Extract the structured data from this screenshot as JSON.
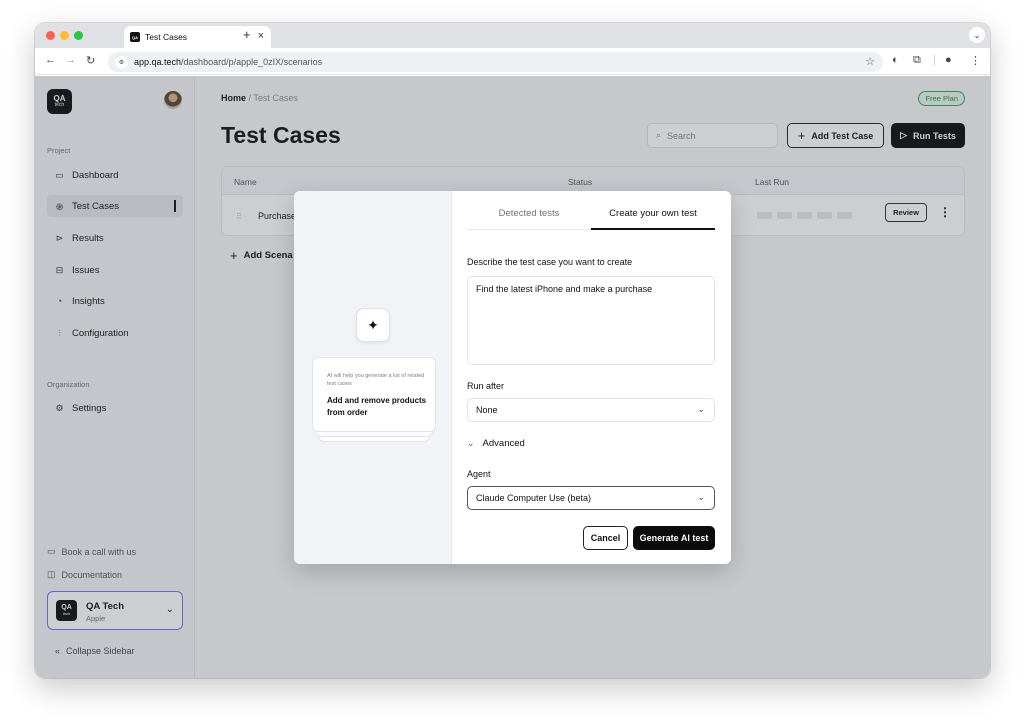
{
  "browser": {
    "tab_title": "Test Cases",
    "tab_favicon": "QA",
    "url_host": "app.qa.tech",
    "url_path": "/dashboard/p/apple_0zIX/scenarios"
  },
  "sidebar": {
    "logo_main": "QA",
    "logo_sub": "tech",
    "project_label": "Project",
    "items": [
      {
        "label": "Dashboard",
        "icon": "calendar-icon"
      },
      {
        "label": "Test Cases",
        "icon": "fingerprint-icon"
      },
      {
        "label": "Results",
        "icon": "play-circle-icon"
      },
      {
        "label": "Issues",
        "icon": "inbox-icon"
      },
      {
        "label": "Insights",
        "icon": "chart-pie-icon"
      },
      {
        "label": "Configuration",
        "icon": "sliders-icon"
      }
    ],
    "organization_label": "Organization",
    "settings_label": "Settings",
    "book_call": "Book a call with us",
    "documentation": "Documentation",
    "org_name": "QA Tech",
    "org_sub": "Apple",
    "collapse": "Collapse Sidebar"
  },
  "main": {
    "breadcrumb_home": "Home",
    "breadcrumb_sep": "/",
    "breadcrumb_current": "Test Cases",
    "plan_badge": "Free Plan",
    "title": "Test Cases",
    "search_placeholder": "Search",
    "add_test_case": "Add Test Case",
    "run_tests": "Run Tests",
    "table": {
      "columns": [
        "Name",
        "Status",
        "Last Run"
      ],
      "row_name": "Purchase",
      "review": "Review"
    },
    "add_scenario": "Add Scena"
  },
  "modal": {
    "tabs": [
      "Detected tests",
      "Create your own test"
    ],
    "active_tab": 1,
    "card_note": "AI will help you generate a list of related test cases",
    "card_title": "Add and remove products from order",
    "describe_label": "Describe the test case you want to create",
    "describe_value": "Find the latest iPhone and make a purchase",
    "run_after_label": "Run after",
    "run_after_value": "None",
    "advanced_label": "Advanced",
    "agent_label": "Agent",
    "agent_value": "Claude Computer Use (beta)",
    "cancel": "Cancel",
    "generate": "Generate AI test"
  },
  "colors": {
    "accent": "#0c0c0c",
    "plan_green": "#2fa55a",
    "org_border": "#7c6cf2"
  }
}
